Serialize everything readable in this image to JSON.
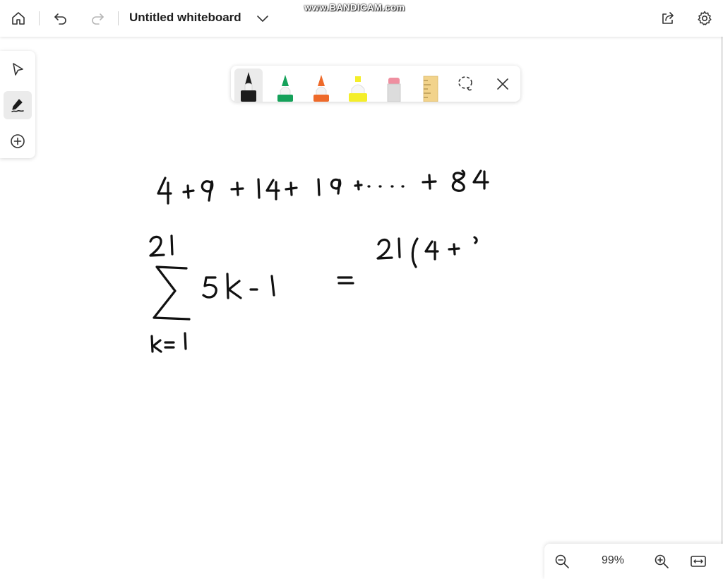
{
  "header": {
    "title": "Untitled whiteboard",
    "watermark": "www.BANDICAM.com",
    "icons": {
      "home": "home-icon",
      "undo": "undo-icon",
      "redo": "redo-icon",
      "chevron": "chevron-down-icon",
      "share": "share-icon",
      "settings": "gear-icon"
    }
  },
  "rail": {
    "tools": [
      "select-icon",
      "pen-icon",
      "add-icon"
    ],
    "active": "pen-icon"
  },
  "pen_toolbar": {
    "pens": [
      {
        "name": "black-pen",
        "color": "#1c1c1c"
      },
      {
        "name": "green-pen",
        "color": "#15a15a"
      },
      {
        "name": "orange-pen",
        "color": "#ee6a2a"
      },
      {
        "name": "yellow-highlighter",
        "color": "#f4ee2a"
      },
      {
        "name": "eraser",
        "color": "#ef8fa0"
      },
      {
        "name": "ruler",
        "color": "#f2d38b"
      }
    ],
    "active": "black-pen",
    "lasso": "lasso-icon",
    "close": "close-icon"
  },
  "canvas": {
    "ink": "4 + 9 + 14 + 19 + .... + 84 ; sum from k=1 to 21 of 5k - 1 = 21(4 +"
  },
  "zoom": {
    "value": "99%",
    "icons": [
      "zoom-out-icon",
      "zoom-in-icon",
      "fit-to-screen-icon"
    ]
  },
  "colors": {
    "accent": "#1f1f1f",
    "ink": "#111111",
    "active_bg": "#ebebeb"
  }
}
